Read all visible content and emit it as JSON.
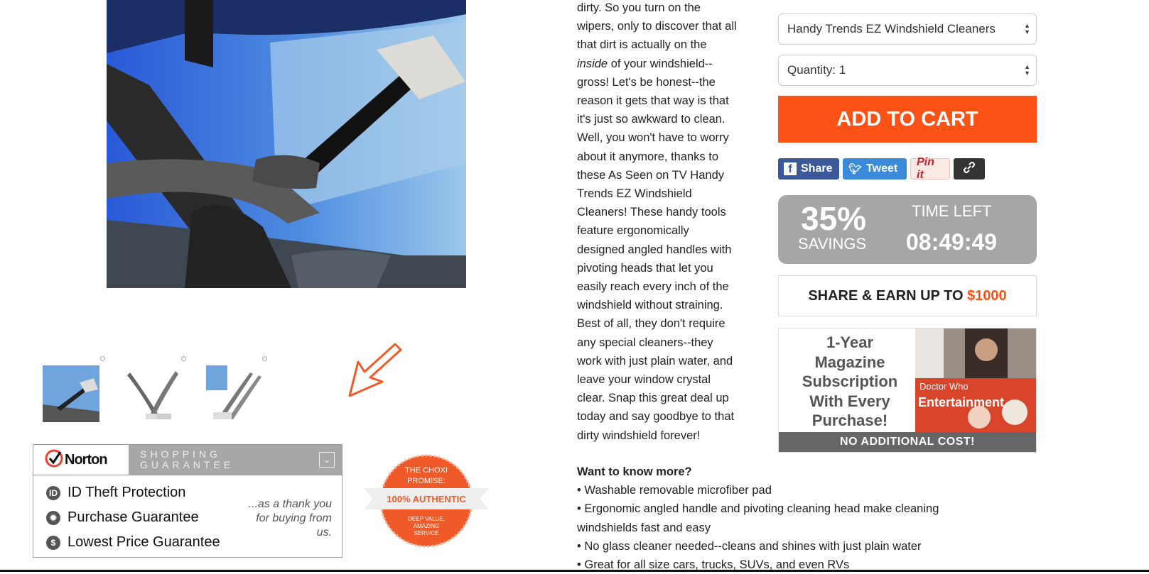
{
  "description": {
    "lines": [
      "dirty. So you turn on the",
      "wipers, only to discover that all",
      "that dirt is actually on the"
    ],
    "inside_word": "inside",
    "inside_rest": " of your windshield--",
    "lines_after": [
      "gross! Let's be honest--the",
      "reason it gets that way is that",
      "it's just so awkward to clean.",
      "Well, you won't have to worry",
      "about it anymore, thanks to",
      "these As Seen on TV Handy",
      "Trends EZ Windshield",
      "Cleaners! These handy tools",
      "feature ergonomically",
      "designed angled handles with",
      "pivoting heads that let you",
      "easily reach every inch of the",
      "windshield without straining.",
      "Best of all, they don't require",
      "any special cleaners--they",
      "work with just plain water, and",
      "leave your window crystal",
      "clear. Snap this great deal up",
      "today and say goodbye to that",
      "dirty windshield forever!"
    ]
  },
  "more": {
    "title": "Want to know more?",
    "bullets": [
      "• Washable removable microfiber pad",
      "• Ergonomic angled handle and pivoting cleaning head make cleaning",
      "windshields fast and easy",
      "• No glass cleaner needed--cleans and shines with just plain water",
      "• Great for all size cars, trucks, SUVs, and even RVs"
    ]
  },
  "product_select": {
    "value": "Handy Trends EZ Windshield Cleaners"
  },
  "quantity_select": {
    "value": "Quantity: 1"
  },
  "add_to_cart": "ADD TO CART",
  "social": {
    "share": "Share",
    "tweet": "Tweet",
    "pin": "Pin it"
  },
  "savings": {
    "percent": "35%",
    "label": "SAVINGS",
    "time_label": "TIME LEFT",
    "time_value": "08:49:49"
  },
  "share_earn": {
    "text": "SHARE & EARN UP TO ",
    "amount": "$1000"
  },
  "magazine": {
    "lines": [
      "1-Year",
      "Magazine",
      "Subscription",
      "With Every",
      "Purchase!"
    ],
    "footer": "NO ADDITIONAL COST!",
    "cover_text_1": "Doctor Who",
    "cover_text_2": "Entertainment"
  },
  "norton": {
    "logo": "Norton",
    "title": "SHOPPING\nGUARANTEE",
    "items": [
      "ID Theft Protection",
      "Purchase Guarantee",
      "Lowest Price Guarantee"
    ],
    "note": "...as a thank you for buying from us."
  },
  "choxi": {
    "line1": "THE CHOXI",
    "line2": "PROMISE:",
    "ribbon": "100% AUTHENTIC",
    "line3": "DEEP VALUE,",
    "line4": "AMAZING",
    "line5": "SERVICE"
  },
  "colors": {
    "accent": "#fc5216",
    "facebook": "#3b5998",
    "twitter": "#3b8ad9",
    "gray_box": "#a6a6a6"
  },
  "icons": [
    "norton-check-icon",
    "id-icon",
    "purchase-icon",
    "dollar-icon",
    "facebook-icon",
    "twitter-icon",
    "link-icon",
    "arrow-icon",
    "chevron-down-icon"
  ]
}
